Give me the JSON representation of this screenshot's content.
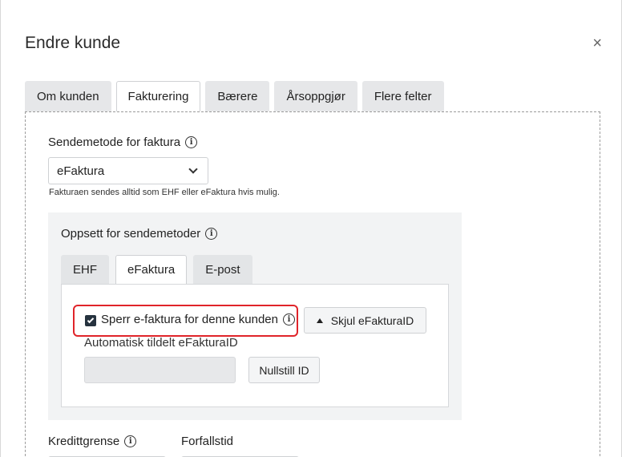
{
  "dialog": {
    "title": "Endre kunde",
    "close_label": "×"
  },
  "tabs": [
    {
      "label": "Om kunden",
      "active": false
    },
    {
      "label": "Fakturering",
      "active": true
    },
    {
      "label": "Bærere",
      "active": false
    },
    {
      "label": "Årsoppgjør",
      "active": false
    },
    {
      "label": "Flere felter",
      "active": false
    }
  ],
  "billing": {
    "send_method_label": "Sendemetode for faktura",
    "send_method_value": "eFaktura",
    "send_method_helper": "Fakturaen sendes alltid som EHF eller eFaktura hvis mulig.",
    "setup_title": "Oppsett for sendemetoder",
    "subtabs": [
      {
        "label": "EHF",
        "active": false
      },
      {
        "label": "eFaktura",
        "active": true
      },
      {
        "label": "E-post",
        "active": false
      }
    ],
    "efaktura": {
      "block_checkbox_label": "Sperr e-faktura for denne kunden",
      "block_checked": true,
      "toggle_button_label": "Skjul eFakturaID",
      "auto_id_label": "Automatisk tildelt eFakturaID",
      "auto_id_value": "",
      "reset_button_label": "Nullstill ID"
    },
    "credit_limit_label": "Kredittgrense",
    "due_label": "Forfallstid"
  },
  "colors": {
    "highlight": "#e0242a",
    "checkbox": "#26333f"
  }
}
